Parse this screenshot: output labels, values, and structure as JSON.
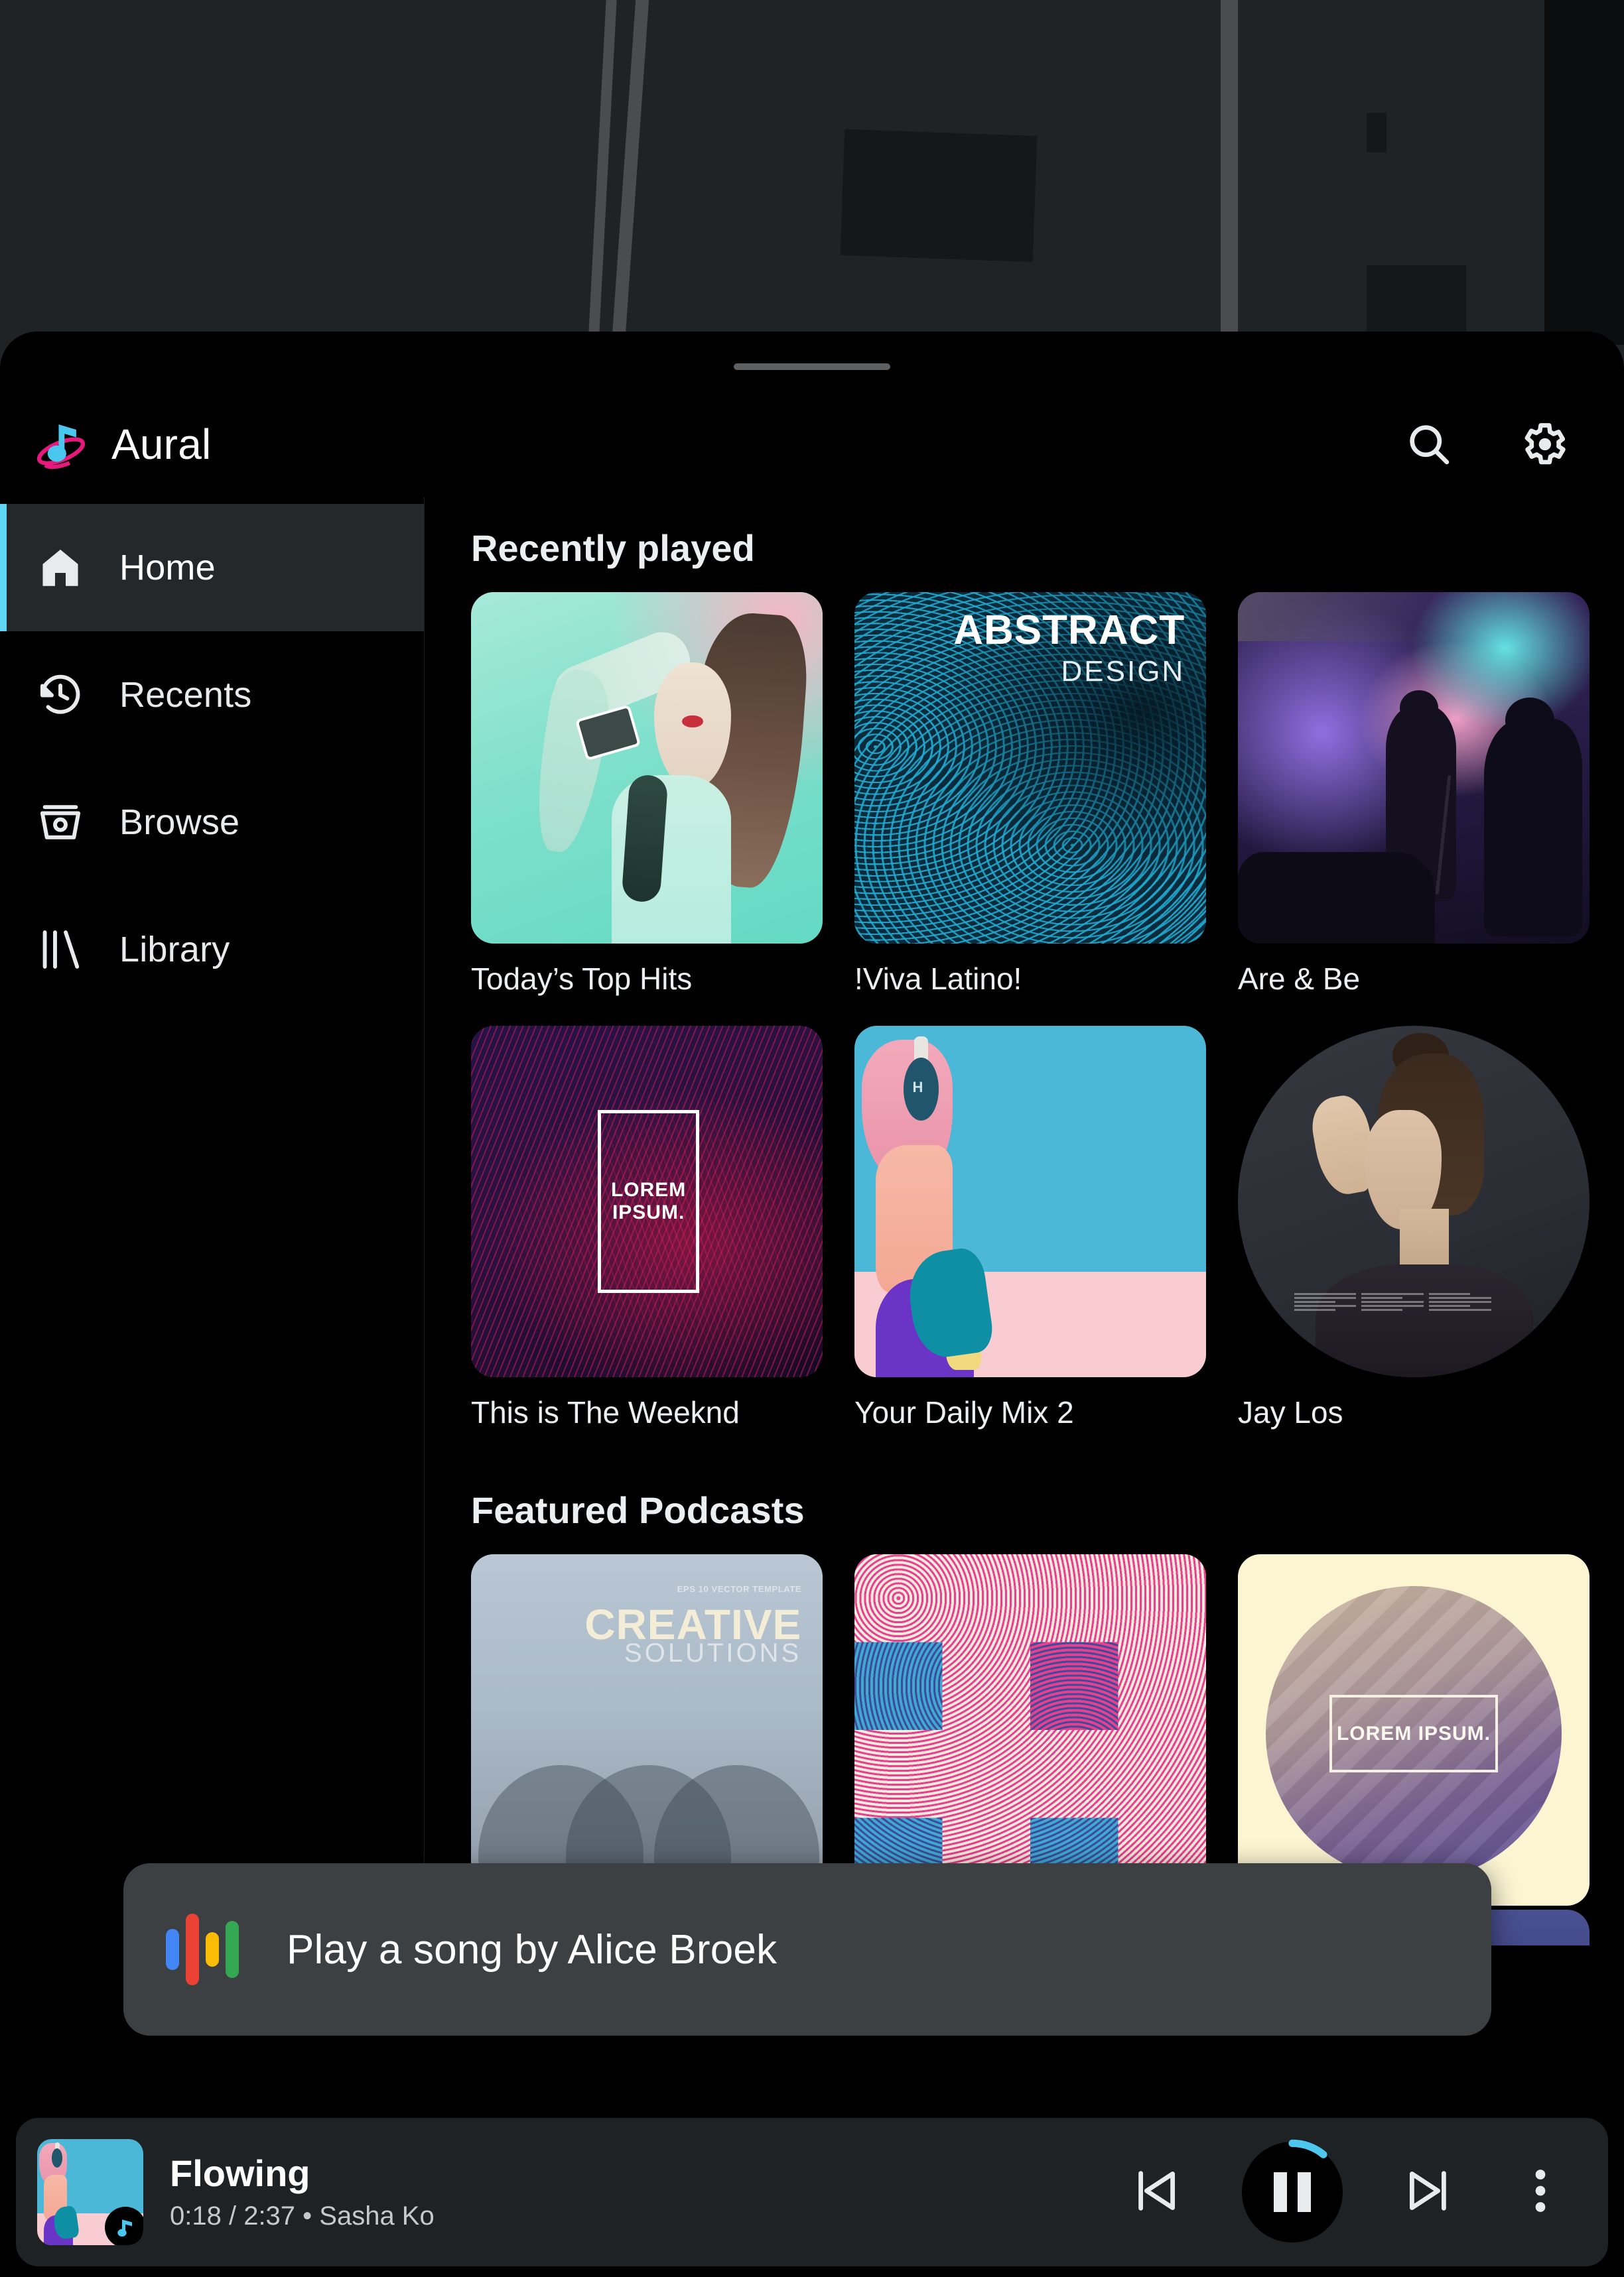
{
  "app": {
    "name": "Aural",
    "logo_icon": "music-note-orbit-logo",
    "accent_color": "#60d6f5",
    "logo_note_color": "#4ac7ef",
    "logo_ring_color": "#e8197d"
  },
  "topbar": {
    "search_icon": "search-icon",
    "settings_icon": "gear-icon"
  },
  "sidebar": {
    "items": [
      {
        "label": "Home",
        "icon": "home-icon",
        "active": true
      },
      {
        "label": "Recents",
        "icon": "history-icon",
        "active": false
      },
      {
        "label": "Browse",
        "icon": "browse-icon",
        "active": false
      },
      {
        "label": "Library",
        "icon": "library-icon",
        "active": false
      }
    ]
  },
  "sections": [
    {
      "title": "Recently played",
      "cards": [
        {
          "label": "Today’s Top Hits",
          "art": "woman-teal-portrait"
        },
        {
          "label": "!Viva Latino!",
          "art": "abstract-design",
          "art_text_1": "ABSTRACT",
          "art_text_2": "DESIGN"
        },
        {
          "label": "Are & Be",
          "art": "concert-stage"
        },
        {
          "label": "This is The Weeknd",
          "art": "purple-crimson-waves",
          "art_text": "LOREM IPSUM.",
          "truncated": true
        },
        {
          "label": "Your Daily Mix 2",
          "art": "pink-hair-headphones"
        },
        {
          "label": "Jay Los",
          "art": "woman-editorial-circle",
          "shape": "circle"
        }
      ]
    },
    {
      "title": "Featured Podcasts",
      "cards": [
        {
          "label": "",
          "art": "creative-solutions",
          "art_tag": "EPS 10 VECTOR TEMPLATE",
          "art_text_1": "CREATIVE",
          "art_text_2": "SOLUTIONS"
        },
        {
          "label": "",
          "art": "geometric-circles-pattern"
        },
        {
          "label": "",
          "art": "gradient-sphere-cream",
          "art_text": "LOREM IPSUM."
        }
      ]
    }
  ],
  "assistant": {
    "icon": "google-assistant-icon",
    "transcript": "Play a song by Alice Broek",
    "dot_colors": [
      "#4285f4",
      "#ea4335",
      "#fbbc05",
      "#34a853"
    ]
  },
  "player": {
    "title": "Flowing",
    "elapsed": "0:18",
    "duration": "2:37",
    "artist": "Sasha Ko",
    "subtitle": "0:18 / 2:37 • Sasha Ko",
    "progress_percent": 11,
    "previous_icon": "skip-previous-icon",
    "play_state_icon": "pause-icon",
    "next_icon": "skip-next-icon",
    "overflow_icon": "more-vertical-icon",
    "progress_color": "#4ec7ee"
  }
}
